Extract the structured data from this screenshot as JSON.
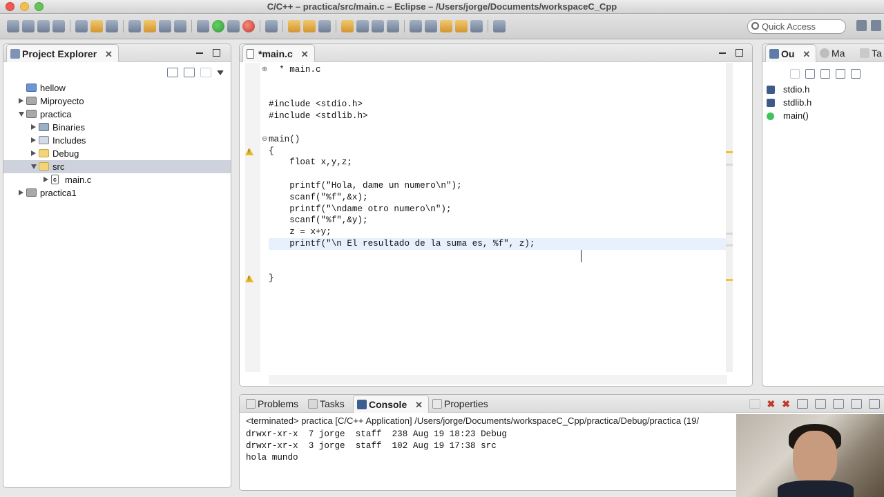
{
  "window": {
    "title": "C/C++ – practica/src/main.c – Eclipse – /Users/jorge/Documents/workspaceC_Cpp"
  },
  "toolbar": {
    "quick_access": "Quick Access"
  },
  "project_explorer": {
    "title": "Project Explorer",
    "items": [
      {
        "label": "hellow",
        "indent": 0,
        "expander": "none",
        "icon": "project-folder-icon"
      },
      {
        "label": "Miproyecto",
        "indent": 0,
        "expander": "collapsed",
        "icon": "c-project-icon"
      },
      {
        "label": "practica",
        "indent": 0,
        "expander": "expanded",
        "icon": "c-project-icon"
      },
      {
        "label": "Binaries",
        "indent": 1,
        "expander": "collapsed",
        "icon": "binaries-icon"
      },
      {
        "label": "Includes",
        "indent": 1,
        "expander": "collapsed",
        "icon": "includes-icon"
      },
      {
        "label": "Debug",
        "indent": 1,
        "expander": "collapsed",
        "icon": "folder-icon"
      },
      {
        "label": "src",
        "indent": 1,
        "expander": "expanded",
        "icon": "folder-icon",
        "selected": true
      },
      {
        "label": "main.c",
        "indent": 2,
        "expander": "collapsed",
        "icon": "c-file-icon"
      },
      {
        "label": "practica1",
        "indent": 0,
        "expander": "collapsed",
        "icon": "c-project-icon"
      }
    ]
  },
  "editor": {
    "tab_label": "*main.c",
    "lines": [
      "  * main.c",
      "",
      "",
      "#include <stdio.h>",
      "#include <stdlib.h>",
      "",
      "main()",
      "{",
      "    float x,y,z;",
      "",
      "    printf(\"Hola, dame un numero\\n\");",
      "    scanf(\"%f\",&x);",
      "    printf(\"\\ndame otro numero\\n\");",
      "    scanf(\"%f\",&y);",
      "    z = x+y;",
      "    printf(\"\\n El resultado de la suma es, %f\", z);",
      "",
      "",
      "}"
    ],
    "current_line": 15,
    "warning_lines": [
      7,
      18
    ]
  },
  "outline": {
    "tabs": [
      "Ou",
      "Ma",
      "Ta"
    ],
    "items": [
      "stdio.h",
      "stdlib.h",
      "main()"
    ]
  },
  "console": {
    "tabs": [
      "Problems",
      "Tasks",
      "Console",
      "Properties"
    ],
    "active_tab": "Console",
    "status": "<terminated> practica [C/C++ Application] /Users/jorge/Documents/workspaceC_Cpp/practica/Debug/practica (19/",
    "lines": [
      "drwxr-xr-x  7 jorge  staff  238 Aug 19 18:23 Debug",
      "drwxr-xr-x  3 jorge  staff  102 Aug 19 17:38 src",
      "hola mundo"
    ]
  }
}
